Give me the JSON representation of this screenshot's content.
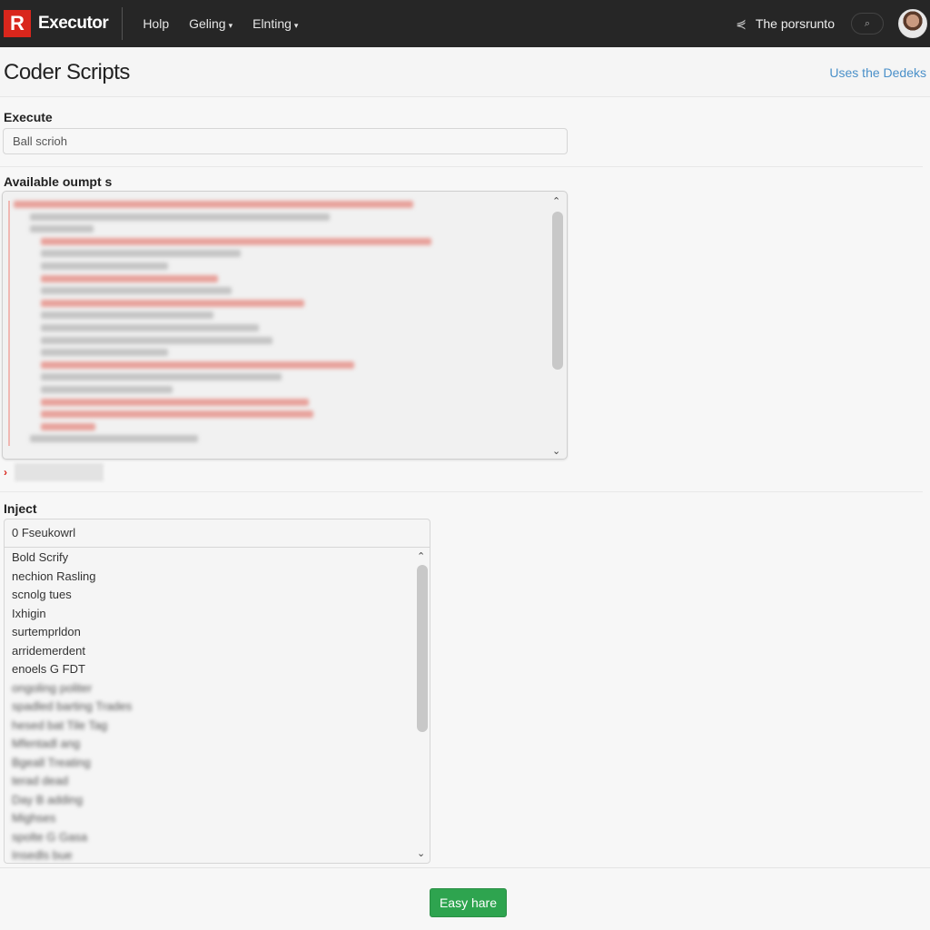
{
  "topbar": {
    "logo_letter": "R",
    "brand": "Executor",
    "nav": [
      {
        "label": "Holp",
        "caret": false
      },
      {
        "label": "Geling",
        "caret": true
      },
      {
        "label": "Elnting",
        "caret": true
      }
    ],
    "user": "The porsrunto",
    "caret": "▾"
  },
  "header": {
    "title": "Coder Scripts",
    "link": "Uses the Dedeks"
  },
  "execute": {
    "label": "Execute",
    "input_value": "Ball scrioh"
  },
  "available": {
    "label": "Available oumpt s"
  },
  "inject": {
    "label": "Inject",
    "input_value": "0 Fseukowrl",
    "items": [
      {
        "label": "Bold Scrify",
        "blurred": false
      },
      {
        "label": "nechion Rasling",
        "blurred": false
      },
      {
        "label": "scnolg tues",
        "blurred": false
      },
      {
        "label": "Iхhigin",
        "blurred": false
      },
      {
        "label": "surtemprldon",
        "blurred": false
      },
      {
        "label": "arridemerdent",
        "blurred": false
      },
      {
        "label": "enoels G FDT",
        "blurred": false
      },
      {
        "label": "ongoling politer",
        "blurred": true
      },
      {
        "label": "spadled barting Trades",
        "blurred": true
      },
      {
        "label": "hesed bat Tile Tag",
        "blurred": true
      },
      {
        "label": "Mfentadl ang",
        "blurred": true
      },
      {
        "label": "Bgeall Treating",
        "blurred": true
      },
      {
        "label": "terad dead",
        "blurred": true
      },
      {
        "label": "Day B adding",
        "blurred": true
      },
      {
        "label": "Mighses",
        "blurred": true
      },
      {
        "label": "spolte G Gasa",
        "blurred": true
      },
      {
        "label": "Insedls bue",
        "blurred": true
      }
    ]
  },
  "action_button": "Easy hare",
  "colors": {
    "accent": "#d9261c",
    "link": "#4a90c9",
    "button": "#2ea44f",
    "topbar": "#262626"
  }
}
